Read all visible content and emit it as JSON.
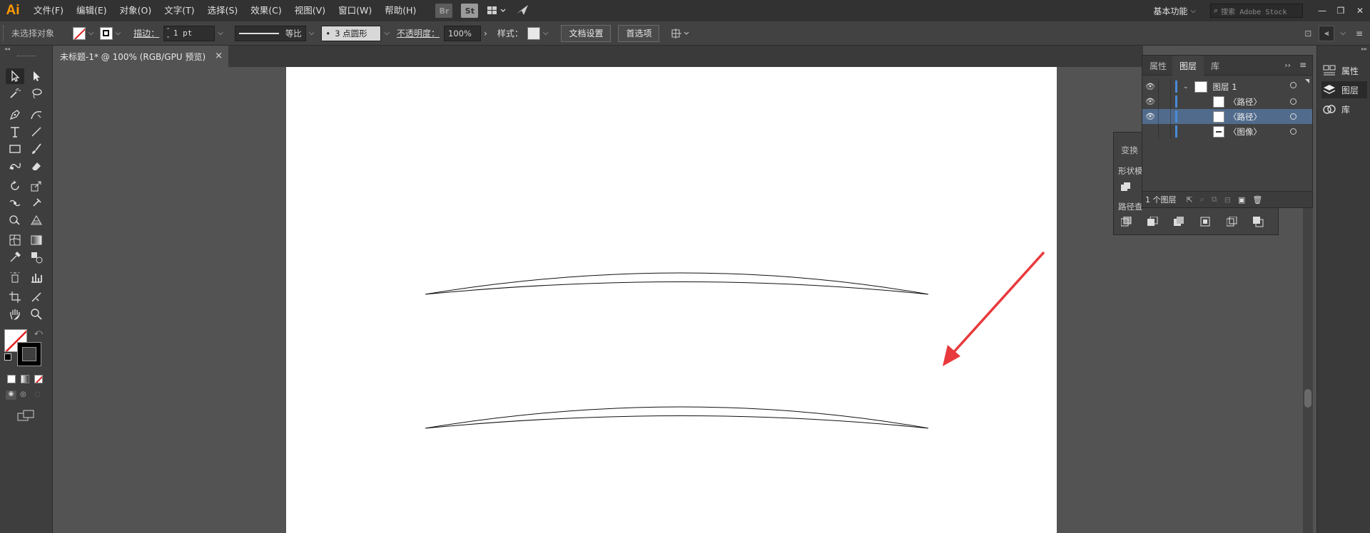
{
  "app": {
    "logo": "Ai"
  },
  "menu": {
    "items": [
      "文件(F)",
      "编辑(E)",
      "对象(O)",
      "文字(T)",
      "选择(S)",
      "效果(C)",
      "视图(V)",
      "窗口(W)",
      "帮助(H)"
    ],
    "bridge_label": "Br",
    "stock_label": "St",
    "workspace": "基本功能",
    "search_placeholder": "搜索 Adobe Stock"
  },
  "control": {
    "selection_label": "未选择对象",
    "stroke_label": "描边：",
    "stroke_value": "1 pt",
    "profile_label": "等比",
    "brush_label": "3 点圆形",
    "opacity_label": "不透明度：",
    "opacity_value": "100%",
    "style_label": "样式：",
    "doc_setup_button": "文档设置",
    "prefs_button": "首选项"
  },
  "document": {
    "tab_title": "未标题-1* @ 100% (RGB/GPU 预览)",
    "close_glyph": "×"
  },
  "layers_panel": {
    "tabs": [
      "属性",
      "图层",
      "库"
    ],
    "active_tab": "图层",
    "rows": [
      {
        "name": "图层 1",
        "visible": true,
        "selected": false,
        "level": 0
      },
      {
        "name": "〈路径〉",
        "visible": true,
        "selected": false,
        "level": 1
      },
      {
        "name": "〈路径〉",
        "visible": true,
        "selected": true,
        "level": 1
      },
      {
        "name": "〈图像〉",
        "visible": false,
        "selected": false,
        "level": 1
      }
    ],
    "footer_count": "1 个图层"
  },
  "transform_panel": {
    "tab": "变换",
    "shape_mode_label": "形状模",
    "pathfinder_label": "路径查"
  },
  "right_dock": {
    "items": [
      "属性",
      "图层",
      "库"
    ]
  },
  "colors": {
    "accent_blue": "#4a8bd8",
    "arrow_red": "#e8393c",
    "selected_row": "#516b8c"
  }
}
